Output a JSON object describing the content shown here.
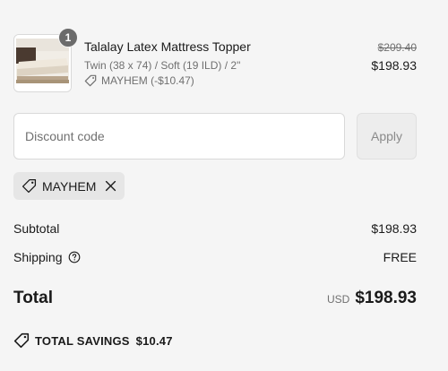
{
  "item": {
    "quantity": "1",
    "title": "Talalay Latex Mattress Topper",
    "variant": "Twin (38 x 74) / Soft (19 ILD) / 2\"",
    "discount_label": "MAYHEM (-$10.47)",
    "compare_price": "$209.40",
    "price": "$198.93",
    "thumbnail_icon": "mattress-image"
  },
  "discount": {
    "placeholder": "Discount code",
    "value": "",
    "apply_label": "Apply",
    "applied_code": "MAYHEM"
  },
  "summary": {
    "subtotal_label": "Subtotal",
    "subtotal_value": "$198.93",
    "shipping_label": "Shipping",
    "shipping_value": "FREE",
    "total_label": "Total",
    "currency": "USD",
    "total_value": "$198.93",
    "savings_label": "TOTAL SAVINGS",
    "savings_value": "$10.47"
  },
  "colors": {
    "background": "#f5f5f5",
    "text": "#1a1a1a",
    "muted": "#707070",
    "badge": "#6b6b6b"
  }
}
